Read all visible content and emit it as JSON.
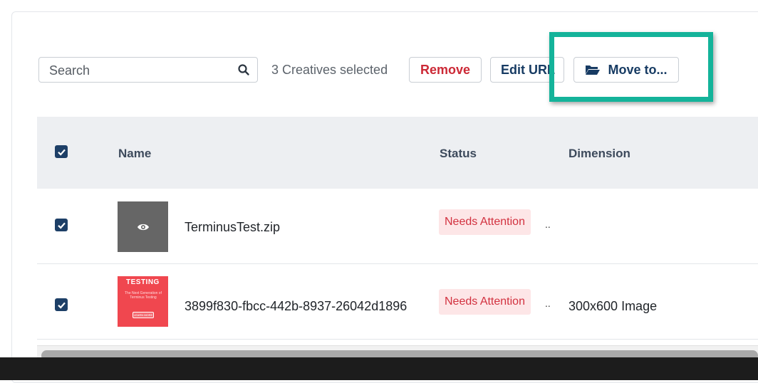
{
  "toolbar": {
    "search_placeholder": "Search",
    "selected_count": "3 Creatives selected",
    "remove_label": "Remove",
    "edit_url_label": "Edit URL",
    "move_to_label": "Move to..."
  },
  "table": {
    "columns": [
      "Name",
      "Status",
      "Dimension"
    ],
    "header_checked": true,
    "rows": [
      {
        "checked": true,
        "thumbnail": "eye-icon",
        "name": "TerminusTest.zip",
        "status": "Needs Attention",
        "extra": "..",
        "dimension": ""
      },
      {
        "checked": true,
        "thumbnail": "banner-preview",
        "thumbnail_text": {
          "title": "TESTING",
          "body": "The Next Generation of Terminus Testing",
          "cta": "LEARN MORE"
        },
        "name": "3899f830-fbcc-442b-8937-26042d1896",
        "status": "Needs Attention",
        "extra": "..",
        "dimension": "300x600 Image"
      }
    ]
  },
  "colors": {
    "highlight": "#14b39a",
    "remove": "#cc2936",
    "primary": "#173b63",
    "checkbox": "#1d3f67",
    "badge_bg": "#fde6e7",
    "badge_text": "#d2313f"
  }
}
